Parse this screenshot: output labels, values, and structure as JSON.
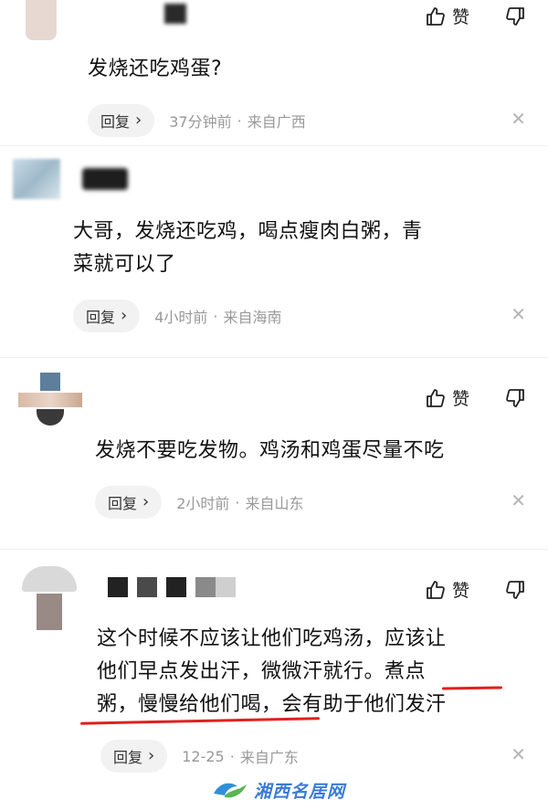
{
  "comments": [
    {
      "text_lines": [
        "发烧还吃鸡蛋?"
      ],
      "like_label": "赞",
      "reply_label": "回复",
      "time": "37分钟前",
      "location": "来自广西"
    },
    {
      "text_lines": [
        "大哥，发烧还吃鸡，喝点瘦肉白粥，青",
        "菜就可以了"
      ],
      "reply_label": "回复",
      "time": "4小时前",
      "location": "来自海南"
    },
    {
      "text_lines": [
        "发烧不要吃发物。鸡汤和鸡蛋尽量不吃"
      ],
      "like_label": "赞",
      "reply_label": "回复",
      "time": "2小时前",
      "location": "来自山东"
    },
    {
      "text_lines": [
        "这个时候不应该让他们吃鸡汤，应该让",
        "他们早点发出汗，微微汗就行。煮点",
        "粥，慢慢给他们喝，会有助于他们发汗"
      ],
      "like_label": "赞",
      "reply_label": "回复",
      "time": "12-25",
      "location": "来自广东"
    }
  ],
  "separator": "·",
  "close_glyph": "✕",
  "chevron_glyph": "›",
  "watermark": {
    "text": "湘西名居网"
  },
  "colors": {
    "highlight": "#e0201d",
    "meta": "#999999",
    "watermark": "#3a7bd5"
  }
}
